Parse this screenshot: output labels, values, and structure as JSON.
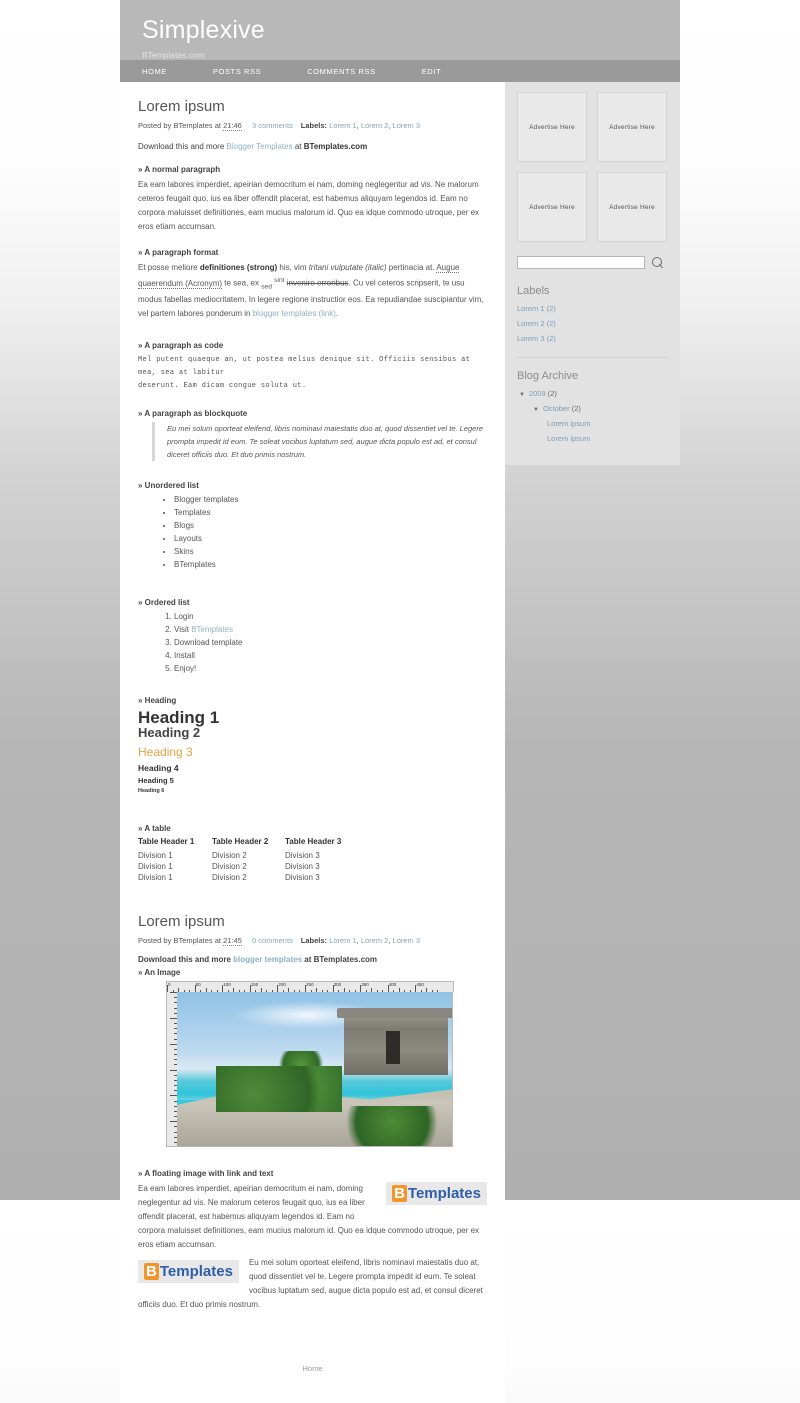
{
  "header": {
    "blog_title": "Simplexive",
    "blog_description": "BTemplates.com"
  },
  "nav": {
    "items": [
      {
        "label": "HOME"
      },
      {
        "label": "POSTS RSS"
      },
      {
        "label": "COMMENTS RSS"
      },
      {
        "label": "EDIT"
      }
    ]
  },
  "posts": [
    {
      "title": "Lorem ipsum",
      "meta": {
        "posted_by": "Posted by BTemplates at",
        "time": "21:46",
        "comments": "3 comments",
        "labels_prefix": "Labels:",
        "labels": [
          "Lorem 1",
          "Lorem 2",
          "Lorem 3"
        ]
      },
      "download": {
        "pre": "Download this and more ",
        "link": "Blogger Templates",
        "mid": " at ",
        "strong": "BTemplates.com"
      },
      "sections": {
        "normal_paragraph_heading": "» A normal paragraph",
        "normal_paragraph": "Ea eam labores imperdiet, apeirian democritum ei nam, doming neglegentur ad vis. Ne malorum ceteros feugait quo, ius ea liber offendit placerat, est habemus aliquyam legendos id. Eam no corpora maluisset definitiones, eam mucius malorum id. Quo ea idque commodo utroque, per ex eros etiam accumsan.",
        "format_heading": "» A paragraph format",
        "format_1": "Et posse meliore ",
        "format_strong": "definitiones (strong)",
        "format_2": " his, vim ",
        "format_italic": "tritani vulputate (italic)",
        "format_3": " pertinacia at. ",
        "format_acronym": "Augue quaerendum (Acronym)",
        "format_4": " te sea, ex ",
        "format_sub": "sed",
        "format_sup": "sint",
        "format_strike": "invenire erroribus",
        "format_5": ". Cu vel ceteros scripserit, te usu modus fabellas mediocritatem. In legere regione instructior eos. Ea repudiandae suscipiantur vim, vel partem labores ponderum in ",
        "format_link": "blogger templates (link)",
        "format_6": ".",
        "code_heading": "» A paragraph as code",
        "code_text": "Mel putent quaeque an, ut postea melius denique sit. Officiis sensibus at mea, sea at labitur\ndeserunt. Eam dicam congue soluta ut.",
        "blockquote_heading": "» A paragraph as blockquote",
        "blockquote_text": "Eu mei solum oporteat eleifend, libris nominavi maiestatis duo at, quod dissentiet vel te. Legere prompta impedit id eum. Te soleat vocibus luptatum sed, augue dicta populo est ad, et consul diceret officiis duo. Et duo primis nostrum.",
        "ul_heading": "» Unordered list",
        "ul_items": [
          "Blogger templates",
          "Templates",
          "Blogs",
          "Layouts",
          "Skins",
          "BTemplates"
        ],
        "ol_heading": "» Ordered list",
        "ol_items": [
          "Login",
          "Visit ",
          "Download template",
          "Install",
          "Enjoy!"
        ],
        "ol_item2_link": "BTemplates",
        "heading_heading": "» Heading",
        "h1": "Heading 1",
        "h2": "Heading 2",
        "h3": "Heading 3",
        "h4": "Heading 4",
        "h5": "Heading 5",
        "h6": "Heading 6",
        "table_heading": "» A table",
        "table": {
          "headers": [
            "Table Header 1",
            "Table Header 2",
            "Table Header 3"
          ],
          "rows": [
            [
              "Division 1",
              "Division 2",
              "Division 3"
            ],
            [
              "Division 1",
              "Division 2",
              "Division 3"
            ],
            [
              "Division 1",
              "Division 2",
              "Division 3"
            ]
          ]
        }
      }
    },
    {
      "title": "Lorem ipsum",
      "meta": {
        "posted_by": "Posted by BTemplates at",
        "time": "21:45",
        "comments": "0 comments",
        "labels_prefix": "Labels:",
        "labels": [
          "Lorem 1",
          "Lorem 2",
          "Lorem 3"
        ]
      },
      "download": {
        "pre": "Download this and more ",
        "link": "blogger templates",
        "mid": " at ",
        "strong": "BTemplates.com"
      },
      "image_heading": "» An Image",
      "ruler_ticks": [
        "0",
        "50",
        "100",
        "150",
        "200",
        "250",
        "300",
        "350",
        "400",
        "450"
      ],
      "floating_heading": "» A floating image with link and text",
      "floating_para_1": "Ea eam labores imperdiet, apeirian democritum ei nam, doming neglegentur ad vis. Ne malorum ceteros feugait quo, ius ea liber offendit placerat, est habemus aliquyam legendos id. Eam no corpora maluisset definitiones, eam mucius malorum id. Quo ea idque commodo utroque, per ex eros etiam accumsan.",
      "floating_para_2": "Eu mei solum oporteat eleifend, libris nominavi maiestatis duo at, quod dissentiet vel te. Legere prompta impedit id eum. Te soleat vocibus luptatum sed, augue dicta populo est ad, et consul diceret officiis duo. Et duo primis nostrum.",
      "logo_b": "B",
      "logo_text": "Templates"
    }
  ],
  "footer": {
    "home_label": "Home"
  },
  "sidebar": {
    "ads": [
      {
        "label": "Advertise Here"
      },
      {
        "label": "Advertise Here"
      },
      {
        "label": "Advertise Here"
      },
      {
        "label": "Advertise Here"
      }
    ],
    "search_placeholder": "",
    "search_value": "",
    "labels_title": "Labels",
    "labels": [
      {
        "name": "Lorem 1",
        "count": "(2)"
      },
      {
        "name": "Lorem 2",
        "count": "(2)"
      },
      {
        "name": "Lorem 3",
        "count": "(2)"
      }
    ],
    "archive_title": "Blog Archive",
    "archive": {
      "year": "2009",
      "year_count": "(2)",
      "month": "October",
      "month_count": "(2)",
      "entries": [
        "Lorem ipsum",
        "Lorem ipsum"
      ]
    }
  },
  "colors": {
    "header_bg": "#b8b8b8",
    "nav_bg": "#9a9a9a",
    "accent_link": "#8fb0c4",
    "heading3": "#e2a444",
    "logo_orange": "#f0962d",
    "logo_blue": "#2f5fa8",
    "sidebar_bg": "#e2e2e2"
  }
}
